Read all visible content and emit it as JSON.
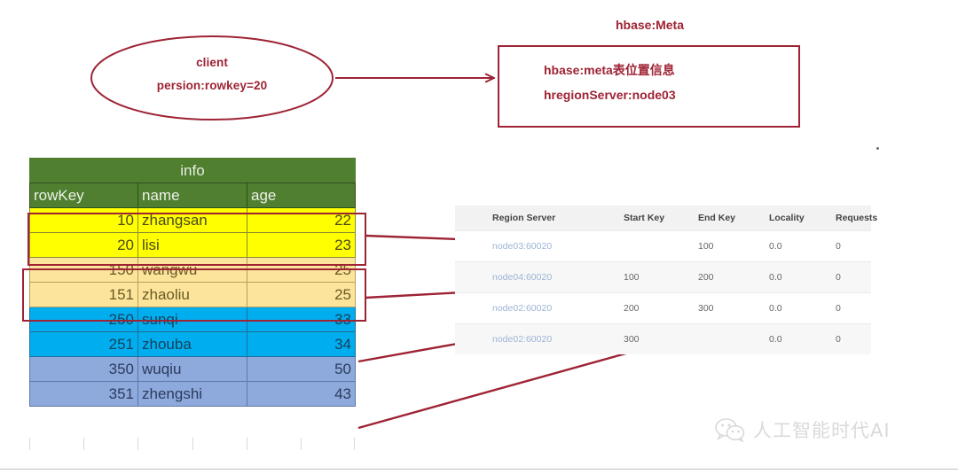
{
  "client": {
    "line1": "client",
    "line2": "persion:rowkey=20"
  },
  "meta": {
    "title": "hbase:Meta",
    "line1": "hbase:meta表位置信息",
    "line2": "hregionServer:node03"
  },
  "sheet": {
    "group_header": "info",
    "columns": [
      "rowKey",
      "name",
      "age"
    ],
    "rows": [
      {
        "rowKey": "10",
        "name": "zhangsan",
        "age": "22",
        "color": "yellow"
      },
      {
        "rowKey": "20",
        "name": "lisi",
        "age": "23",
        "color": "yellow"
      },
      {
        "rowKey": "150",
        "name": "wangwu",
        "age": "25",
        "color": "orange"
      },
      {
        "rowKey": "151",
        "name": "zhaoliu",
        "age": "25",
        "color": "orange"
      },
      {
        "rowKey": "250",
        "name": "sunqi",
        "age": "33",
        "color": "cyan"
      },
      {
        "rowKey": "251",
        "name": "zhouba",
        "age": "34",
        "color": "cyan"
      },
      {
        "rowKey": "350",
        "name": "wuqiu",
        "age": "50",
        "color": "peri"
      },
      {
        "rowKey": "351",
        "name": "zhengshi",
        "age": "43",
        "color": "peri"
      }
    ]
  },
  "regions": {
    "columns": [
      "Region Server",
      "Start Key",
      "End Key",
      "Locality",
      "Requests"
    ],
    "rows": [
      {
        "server": "node03:60020",
        "start": "",
        "end": "100",
        "locality": "0.0",
        "requests": "0"
      },
      {
        "server": "node04:60020",
        "start": "100",
        "end": "200",
        "locality": "0.0",
        "requests": "0"
      },
      {
        "server": "node02:60020",
        "start": "200",
        "end": "300",
        "locality": "0.0",
        "requests": "0"
      },
      {
        "server": "node02:60020",
        "start": "300",
        "end": "",
        "locality": "0.0",
        "requests": "0"
      }
    ]
  },
  "watermark": {
    "text": "人工智能时代AI"
  },
  "colors": {
    "annotation_red": "#9e2334",
    "header_green": "#4f7f2f",
    "row_yellow": "#ffff00",
    "row_orange": "#fce49b",
    "row_cyan": "#00aeef",
    "row_periwinkle": "#8ea9db",
    "node_link_blue": "#9cb4d4"
  }
}
